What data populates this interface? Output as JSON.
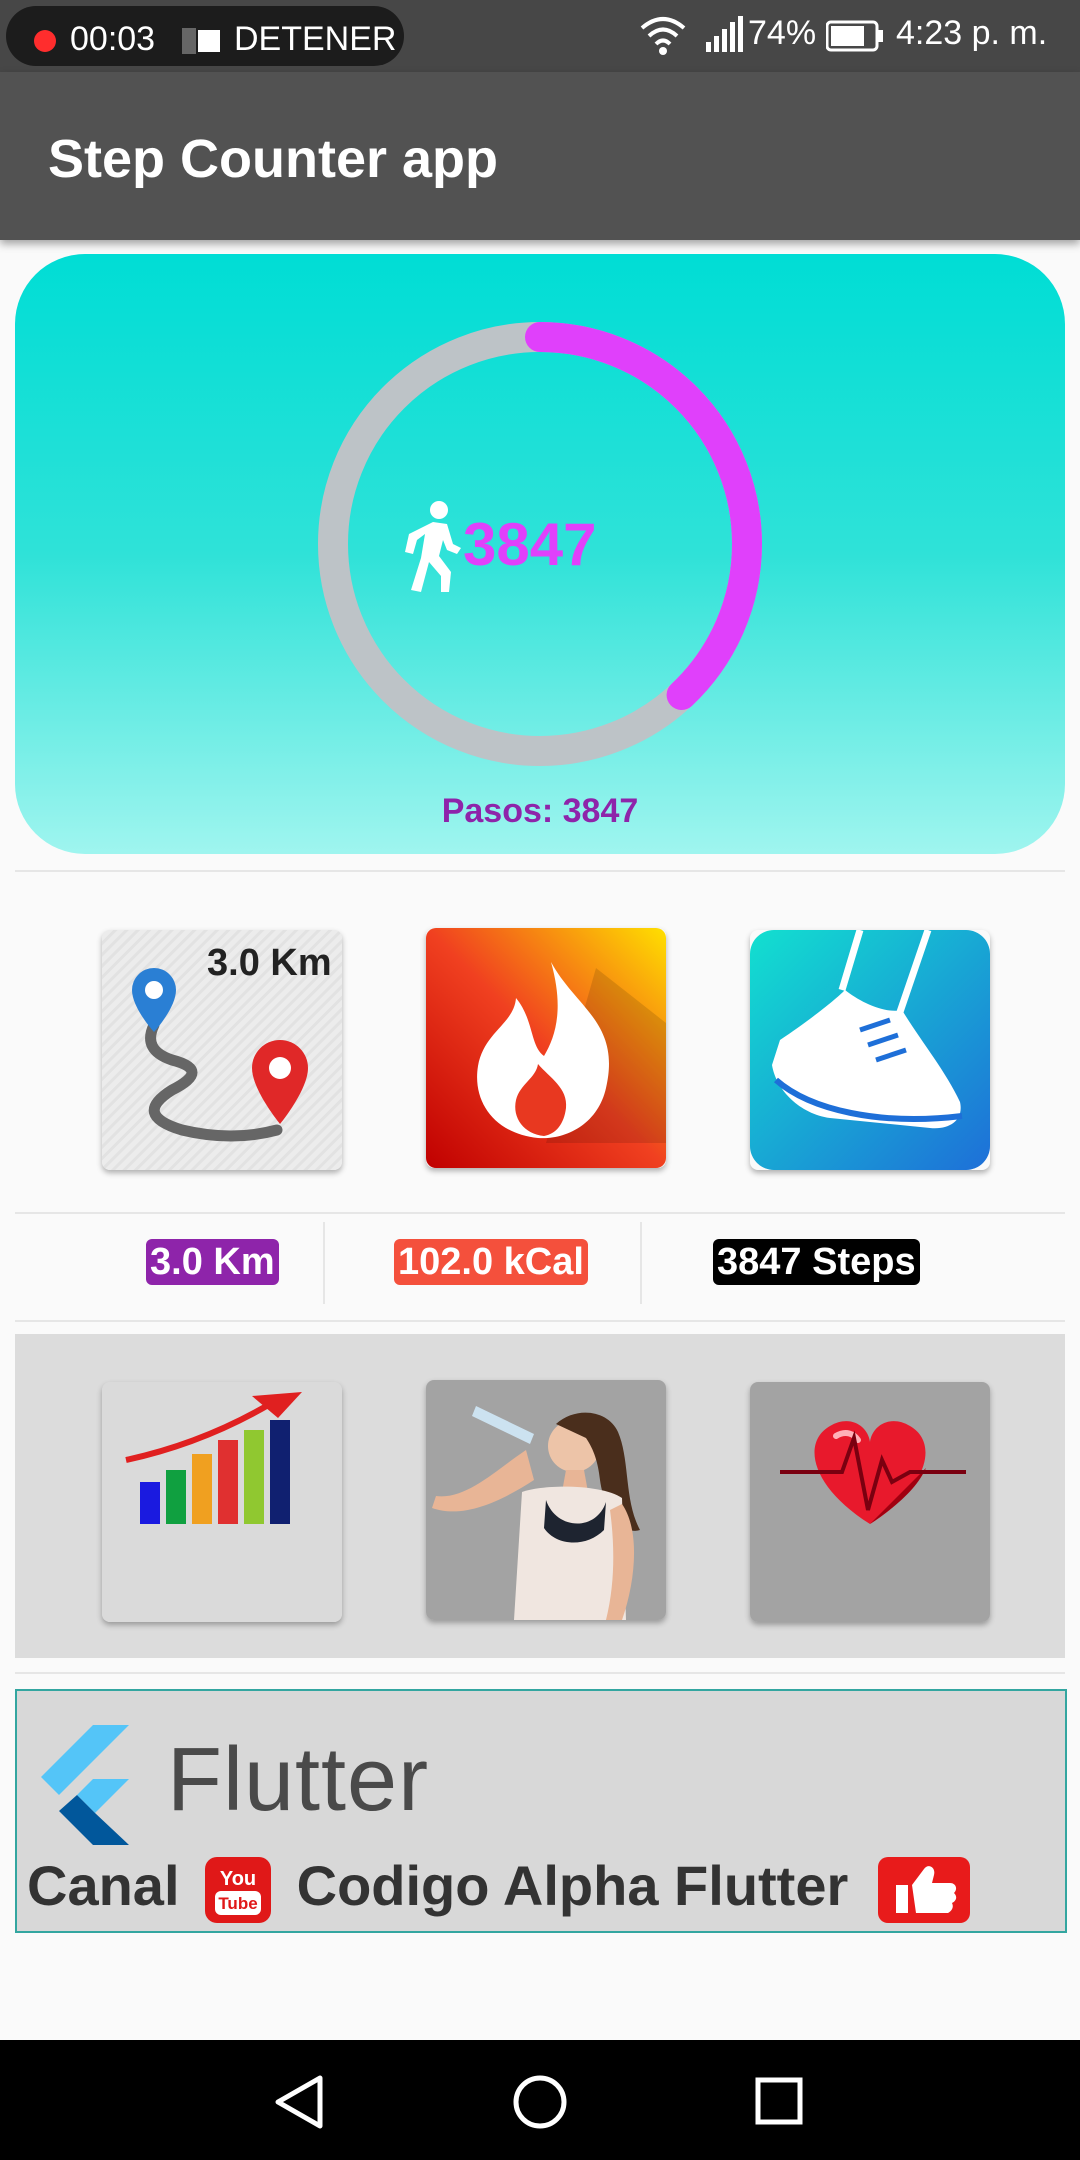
{
  "status_bar": {
    "rec_time": "00:03",
    "stop_label": "DETENER",
    "battery_percent": "74%",
    "clock": "4:23 p. m.",
    "icons": [
      "record-icon",
      "stop-icon",
      "wifi-icon",
      "signal-icon",
      "battery-icon"
    ]
  },
  "app_bar": {
    "title": "Step Counter app"
  },
  "progress": {
    "steps": "3847",
    "caption": "Pasos:  3847",
    "ring_fraction": 0.38,
    "colors": {
      "track": "#bdc3c7",
      "arc": "#e040fb",
      "text": "#e040fb",
      "caption": "#8e24aa"
    }
  },
  "tiles_row1": {
    "distance_label": "3.0 Km",
    "icons": [
      "route-map-icon",
      "fire-icon",
      "sneaker-icon"
    ]
  },
  "stats": {
    "distance": "3.0 Km",
    "calories": "102.0 kCal",
    "steps": "3847 Steps",
    "colors": {
      "distance": "#8e24aa",
      "calories": "#f4503c",
      "steps": "#000000"
    }
  },
  "tiles_row2": {
    "icons": [
      "growth-chart-icon",
      "drinking-water-photo",
      "heart-rate-icon"
    ]
  },
  "banner": {
    "title": "Flutter",
    "channel_word": "Canal",
    "channel_name": "Codigo Alpha Flutter",
    "yt_text": "You Tube"
  },
  "nav_bar": {
    "icons": [
      "back-icon",
      "home-icon",
      "recents-icon"
    ]
  }
}
